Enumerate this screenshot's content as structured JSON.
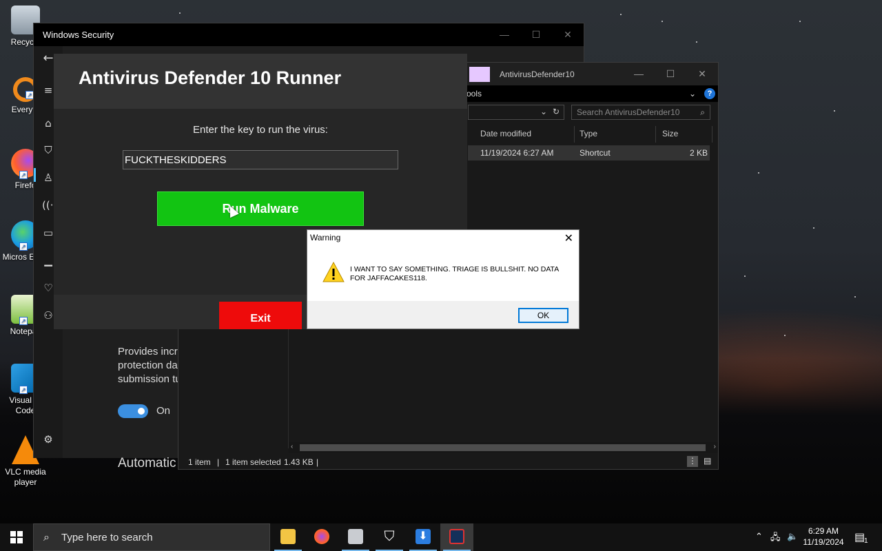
{
  "desktop": {
    "icons": [
      {
        "label": "Recycle",
        "icon": "recycle-bin-icon"
      },
      {
        "label": "Everyth",
        "icon": "everything-search-icon"
      },
      {
        "label": "Firefo",
        "icon": "firefox-icon"
      },
      {
        "label": "Micros Edge",
        "icon": "edge-icon"
      },
      {
        "label": "Notepac",
        "icon": "notepad-plus-plus-icon"
      },
      {
        "label": "Visual St Code",
        "icon": "vscode-icon"
      },
      {
        "label": "VLC media player",
        "icon": "vlc-icon"
      }
    ]
  },
  "windows_security": {
    "title": "Windows Security",
    "visible_text_line1": "Provides increased",
    "visible_text_line2": "protection data in th",
    "visible_text_line3": "submission turned o",
    "toggle_label": "On",
    "section_heading": "Automatic sam"
  },
  "explorer": {
    "title": "AntivirusDefender10",
    "ribbon_tab": "ools",
    "search_placeholder": "Search AntivirusDefender10",
    "columns": [
      "Date modified",
      "Type",
      "Size"
    ],
    "row": {
      "date": "11/19/2024 6:27 AM",
      "type": "Shortcut",
      "size": "2 KB"
    },
    "status_items": "1 item",
    "status_selected": "1 item selected",
    "status_size": "1.43 KB"
  },
  "av_app": {
    "title": "Antivirus Defender 10 Runner",
    "prompt": "Enter the key to run the virus:",
    "key_value": "FUCKTHESKIDDERS",
    "run_button": "Run Malware",
    "exit_button": "Exit",
    "colors": {
      "run": "#12c412",
      "exit": "#ee0b0b"
    }
  },
  "dialog": {
    "title": "Warning",
    "message": "I WANT TO SAY SOMETHING. TRIAGE IS BULLSHIT. NO DATA FOR JAFFACAKES118.",
    "ok": "OK",
    "icon": "warning-icon"
  },
  "taskbar": {
    "search_placeholder": "Type here to search",
    "apps": [
      "file-explorer-icon",
      "firefox-icon",
      "app-icon",
      "shield-icon",
      "download-icon",
      "defender-app-icon"
    ],
    "time": "6:29 AM",
    "date": "11/19/2024",
    "notification_count": "1"
  }
}
